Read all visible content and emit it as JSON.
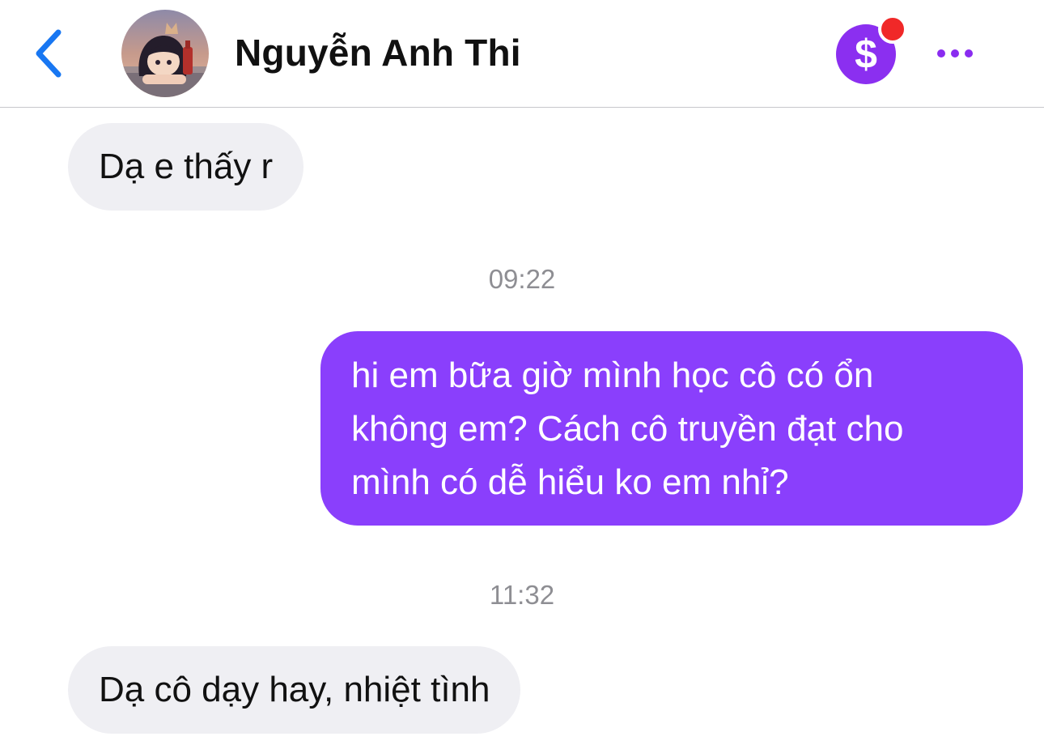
{
  "header": {
    "contact_name": "Nguyễn Anh Thi",
    "back_icon": "chevron-left-icon",
    "pay_icon": "dollar-icon",
    "more_icon": "more-horizontal-icon"
  },
  "messages": [
    {
      "type": "received",
      "text": "Dạ e thấy r"
    },
    {
      "type": "timestamp",
      "text": "09:22"
    },
    {
      "type": "sent",
      "lines": [
        "hi em bữa giờ mình học cô có ổn",
        "không em? Cách cô truyền đạt cho",
        "mình có dễ hiểu ko em nhỉ?"
      ]
    },
    {
      "type": "timestamp",
      "text": "11:32"
    },
    {
      "type": "received",
      "text": "Dạ cô dạy hay, nhiệt tình"
    }
  ],
  "colors": {
    "accent_blue": "#1877f2",
    "sent_bubble": "#8a3ffc",
    "received_bubble": "#efeff3",
    "notification_dot": "#f02828",
    "pay_circle": "#8b2ff0"
  }
}
